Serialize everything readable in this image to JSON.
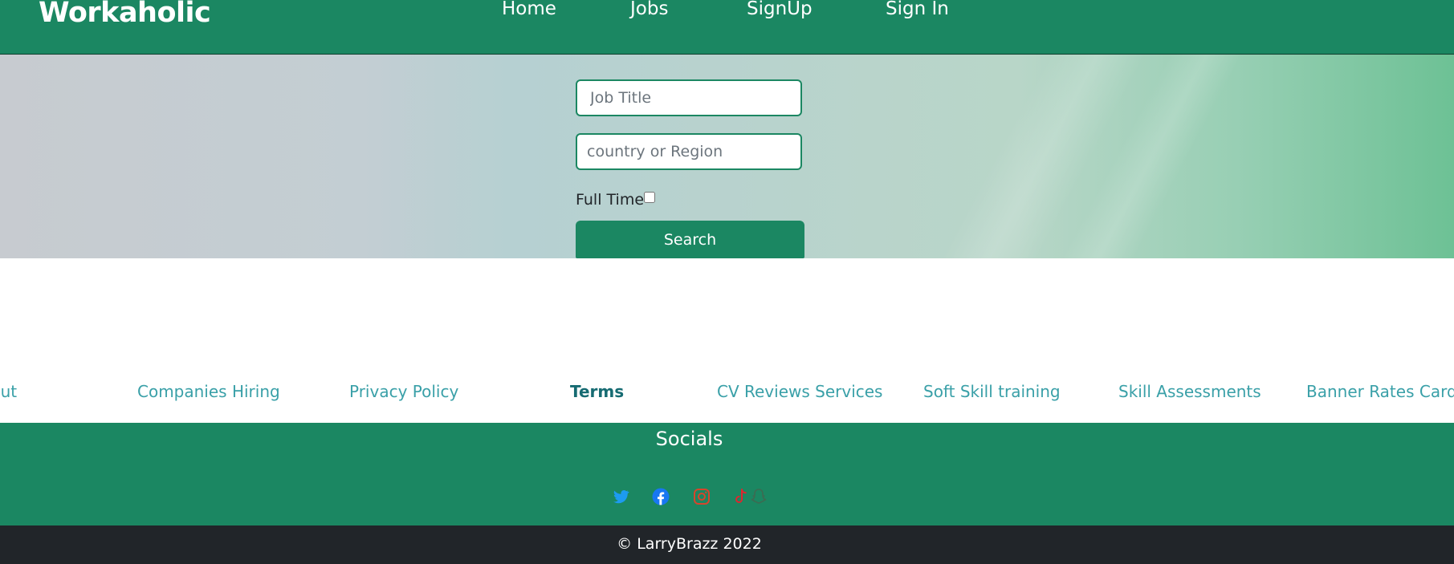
{
  "navbar": {
    "brand": "Workaholic",
    "links": [
      "Home",
      "Jobs",
      "SignUp",
      "Sign In"
    ]
  },
  "search_form": {
    "job_title_placeholder": "Job Title",
    "location_placeholder": "country or Region",
    "full_time_label": "Full Time",
    "full_time_checked": false,
    "search_label": "Search"
  },
  "footer": {
    "links": [
      "About",
      "Companies Hiring",
      "Privacy Policy",
      "Terms",
      "CV Reviews Services",
      "Soft Skill training",
      "Skill Assessments",
      "Banner Rates Cards"
    ],
    "active_link": "Terms",
    "socials_title": "Socials",
    "social_icons": [
      "twitter-icon",
      "facebook-icon",
      "instagram-icon",
      "tiktok-icon",
      "snapchat-icon"
    ],
    "copyright": "© LarryBrazz 2022"
  },
  "colors": {
    "primary": "#1b8762",
    "footer_dark": "#212529",
    "link": "#3aa0a8",
    "twitter": "#1d9bf0",
    "facebook": "#1877f2",
    "instagram": "#d6452c",
    "tiktok": "#e0252e",
    "snapchat": "#3c6b52"
  }
}
